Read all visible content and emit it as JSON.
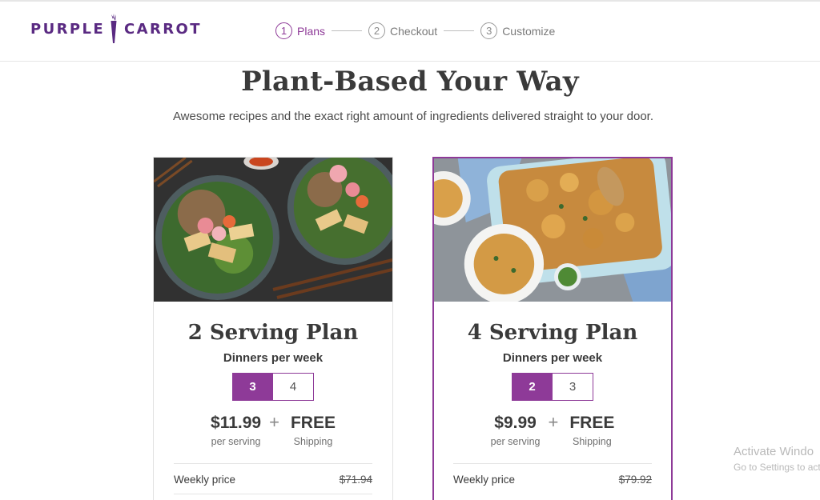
{
  "brand": {
    "logo_left": "PURPLE",
    "logo_right": "CARROT",
    "logo_color": "#5a2a82",
    "accent": "#8e3a98"
  },
  "steps": [
    {
      "num": "1",
      "label": "Plans",
      "active": true
    },
    {
      "num": "2",
      "label": "Checkout",
      "active": false
    },
    {
      "num": "3",
      "label": "Customize",
      "active": false
    }
  ],
  "hero": {
    "title": "Plant-Based Your Way",
    "subtitle": "Awesome recipes and the exact right amount of ingredients delivered straight to your door."
  },
  "plans": [
    {
      "image": "bowls-with-tofu-and-radish-salad",
      "title": "2 Serving Plan",
      "dinners_label": "Dinners per week",
      "options": [
        "3",
        "4"
      ],
      "selected_option": "3",
      "price": "$11.99",
      "price_unit": "per serving",
      "plus": "+",
      "shipping": "FREE",
      "shipping_label": "Shipping",
      "weekly_label": "Weekly price",
      "weekly_price_old": "$71.94",
      "selected": false
    },
    {
      "image": "baked-macaroni-casserole",
      "title": "4 Serving Plan",
      "dinners_label": "Dinners per week",
      "options": [
        "2",
        "3"
      ],
      "selected_option": "2",
      "price": "$9.99",
      "price_unit": "per serving",
      "plus": "+",
      "shipping": "FREE",
      "shipping_label": "Shipping",
      "weekly_label": "Weekly price",
      "weekly_price_old": "$79.92",
      "selected": true
    }
  ],
  "watermark": {
    "line1": "Activate Windo",
    "line2": "Go to Settings to act"
  }
}
